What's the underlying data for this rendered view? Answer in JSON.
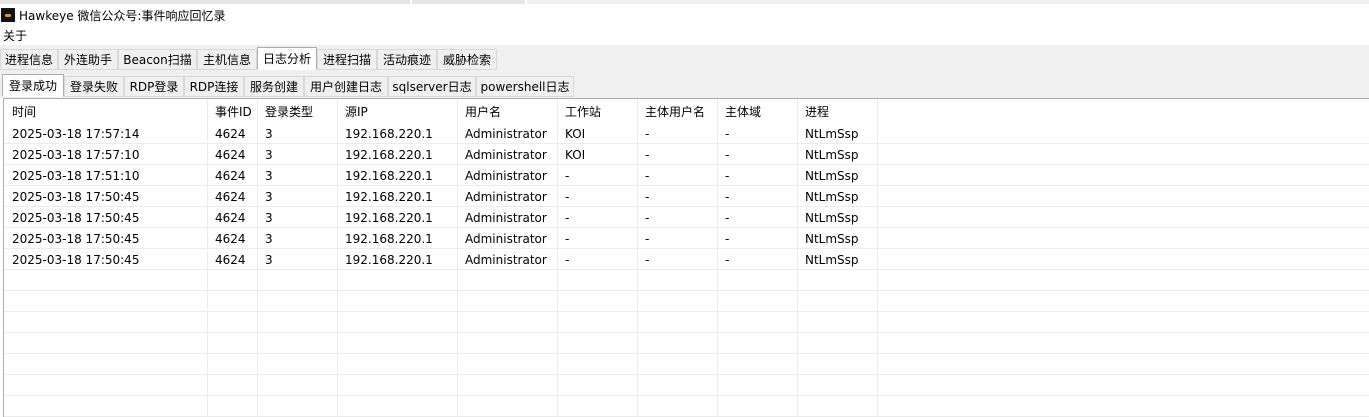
{
  "window": {
    "title": "Hawkeye 微信公众号:事件响应回忆录"
  },
  "menu": {
    "about": "关于"
  },
  "main_tabs": [
    {
      "label": "进程信息"
    },
    {
      "label": "外连助手"
    },
    {
      "label": "Beacon扫描"
    },
    {
      "label": "主机信息"
    },
    {
      "label": "日志分析",
      "active": true
    },
    {
      "label": "进程扫描"
    },
    {
      "label": "活动痕迹"
    },
    {
      "label": "威胁检索"
    }
  ],
  "sub_tabs": [
    {
      "label": "登录成功",
      "active": true
    },
    {
      "label": "登录失败"
    },
    {
      "label": "RDP登录"
    },
    {
      "label": "RDP连接"
    },
    {
      "label": "服务创建"
    },
    {
      "label": "用户创建日志"
    },
    {
      "label": "sqlserver日志"
    },
    {
      "label": "powershell日志"
    }
  ],
  "table": {
    "columns": [
      "时间",
      "事件ID",
      "登录类型",
      "源IP",
      "用户名",
      "工作站",
      "主体用户名",
      "主体域",
      "进程"
    ],
    "rows": [
      [
        "2025-03-18 17:57:14",
        "4624",
        "3",
        "192.168.220.1",
        "Administrator",
        "KOI",
        "-",
        "-",
        "NtLmSsp"
      ],
      [
        "2025-03-18 17:57:10",
        "4624",
        "3",
        "192.168.220.1",
        "Administrator",
        "KOI",
        "-",
        "-",
        "NtLmSsp"
      ],
      [
        "2025-03-18 17:51:10",
        "4624",
        "3",
        "192.168.220.1",
        "Administrator",
        "-",
        "-",
        "-",
        "NtLmSsp"
      ],
      [
        "2025-03-18 17:50:45",
        "4624",
        "3",
        "192.168.220.1",
        "Administrator",
        "-",
        "-",
        "-",
        "NtLmSsp"
      ],
      [
        "2025-03-18 17:50:45",
        "4624",
        "3",
        "192.168.220.1",
        "Administrator",
        "-",
        "-",
        "-",
        "NtLmSsp"
      ],
      [
        "2025-03-18 17:50:45",
        "4624",
        "3",
        "192.168.220.1",
        "Administrator",
        "-",
        "-",
        "-",
        "NtLmSsp"
      ],
      [
        "2025-03-18 17:50:45",
        "4624",
        "3",
        "192.168.220.1",
        "Administrator",
        "-",
        "-",
        "-",
        "NtLmSsp"
      ]
    ]
  }
}
